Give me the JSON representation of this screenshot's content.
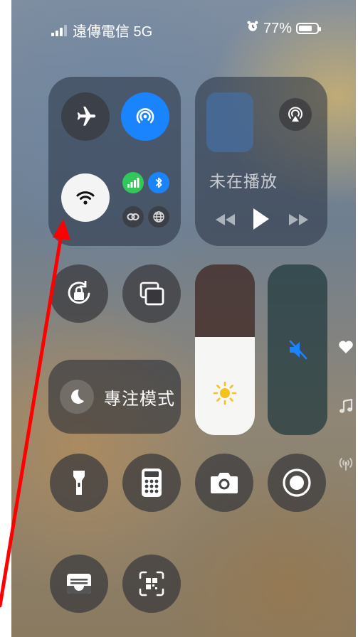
{
  "status_bar": {
    "carrier": "遠傳電信 5G",
    "battery_percent": "77%",
    "battery_level": 0.77,
    "alarm_icon": "alarm-clock-icon",
    "signal_icon": "cellular-signal-icon"
  },
  "connectivity": {
    "airplane_mode": {
      "icon": "airplane-icon",
      "on": false
    },
    "airdrop": {
      "icon": "airdrop-icon",
      "on": true
    },
    "wifi": {
      "icon": "wifi-icon",
      "on": true
    },
    "cellular_data": {
      "icon": "cellular-data-icon",
      "on": true
    },
    "bluetooth": {
      "icon": "bluetooth-icon",
      "on": true
    },
    "personal_hotspot": {
      "icon": "link-icon",
      "on": false
    },
    "vpn": {
      "icon": "globe-icon",
      "on": false
    }
  },
  "now_playing": {
    "status_text": "未在播放",
    "airplay_icon": "airplay-audio-icon",
    "controls": [
      "rewind-icon",
      "play-icon",
      "fast-forward-icon"
    ]
  },
  "focus": {
    "label": "專注模式",
    "icon": "moon-icon"
  },
  "brightness": {
    "level": 0.5,
    "icon": "sun-icon"
  },
  "volume": {
    "level": 0.0,
    "icon": "speaker-muted-icon"
  },
  "controls": [
    {
      "name": "orientation-lock",
      "icon": "rotation-lock-icon"
    },
    {
      "name": "screen-mirroring",
      "icon": "screen-mirroring-icon"
    },
    {
      "name": "flashlight",
      "icon": "flashlight-icon"
    },
    {
      "name": "calculator",
      "icon": "calculator-icon"
    },
    {
      "name": "camera",
      "icon": "camera-icon"
    },
    {
      "name": "screen-recording",
      "icon": "record-icon"
    },
    {
      "name": "wallet",
      "icon": "wallet-icon"
    },
    {
      "name": "qr-scanner",
      "icon": "qr-code-icon"
    }
  ],
  "side_indicators": [
    "heart-icon",
    "music-note-icon",
    "antenna-icon"
  ],
  "annotation": {
    "color": "#ff0000"
  }
}
